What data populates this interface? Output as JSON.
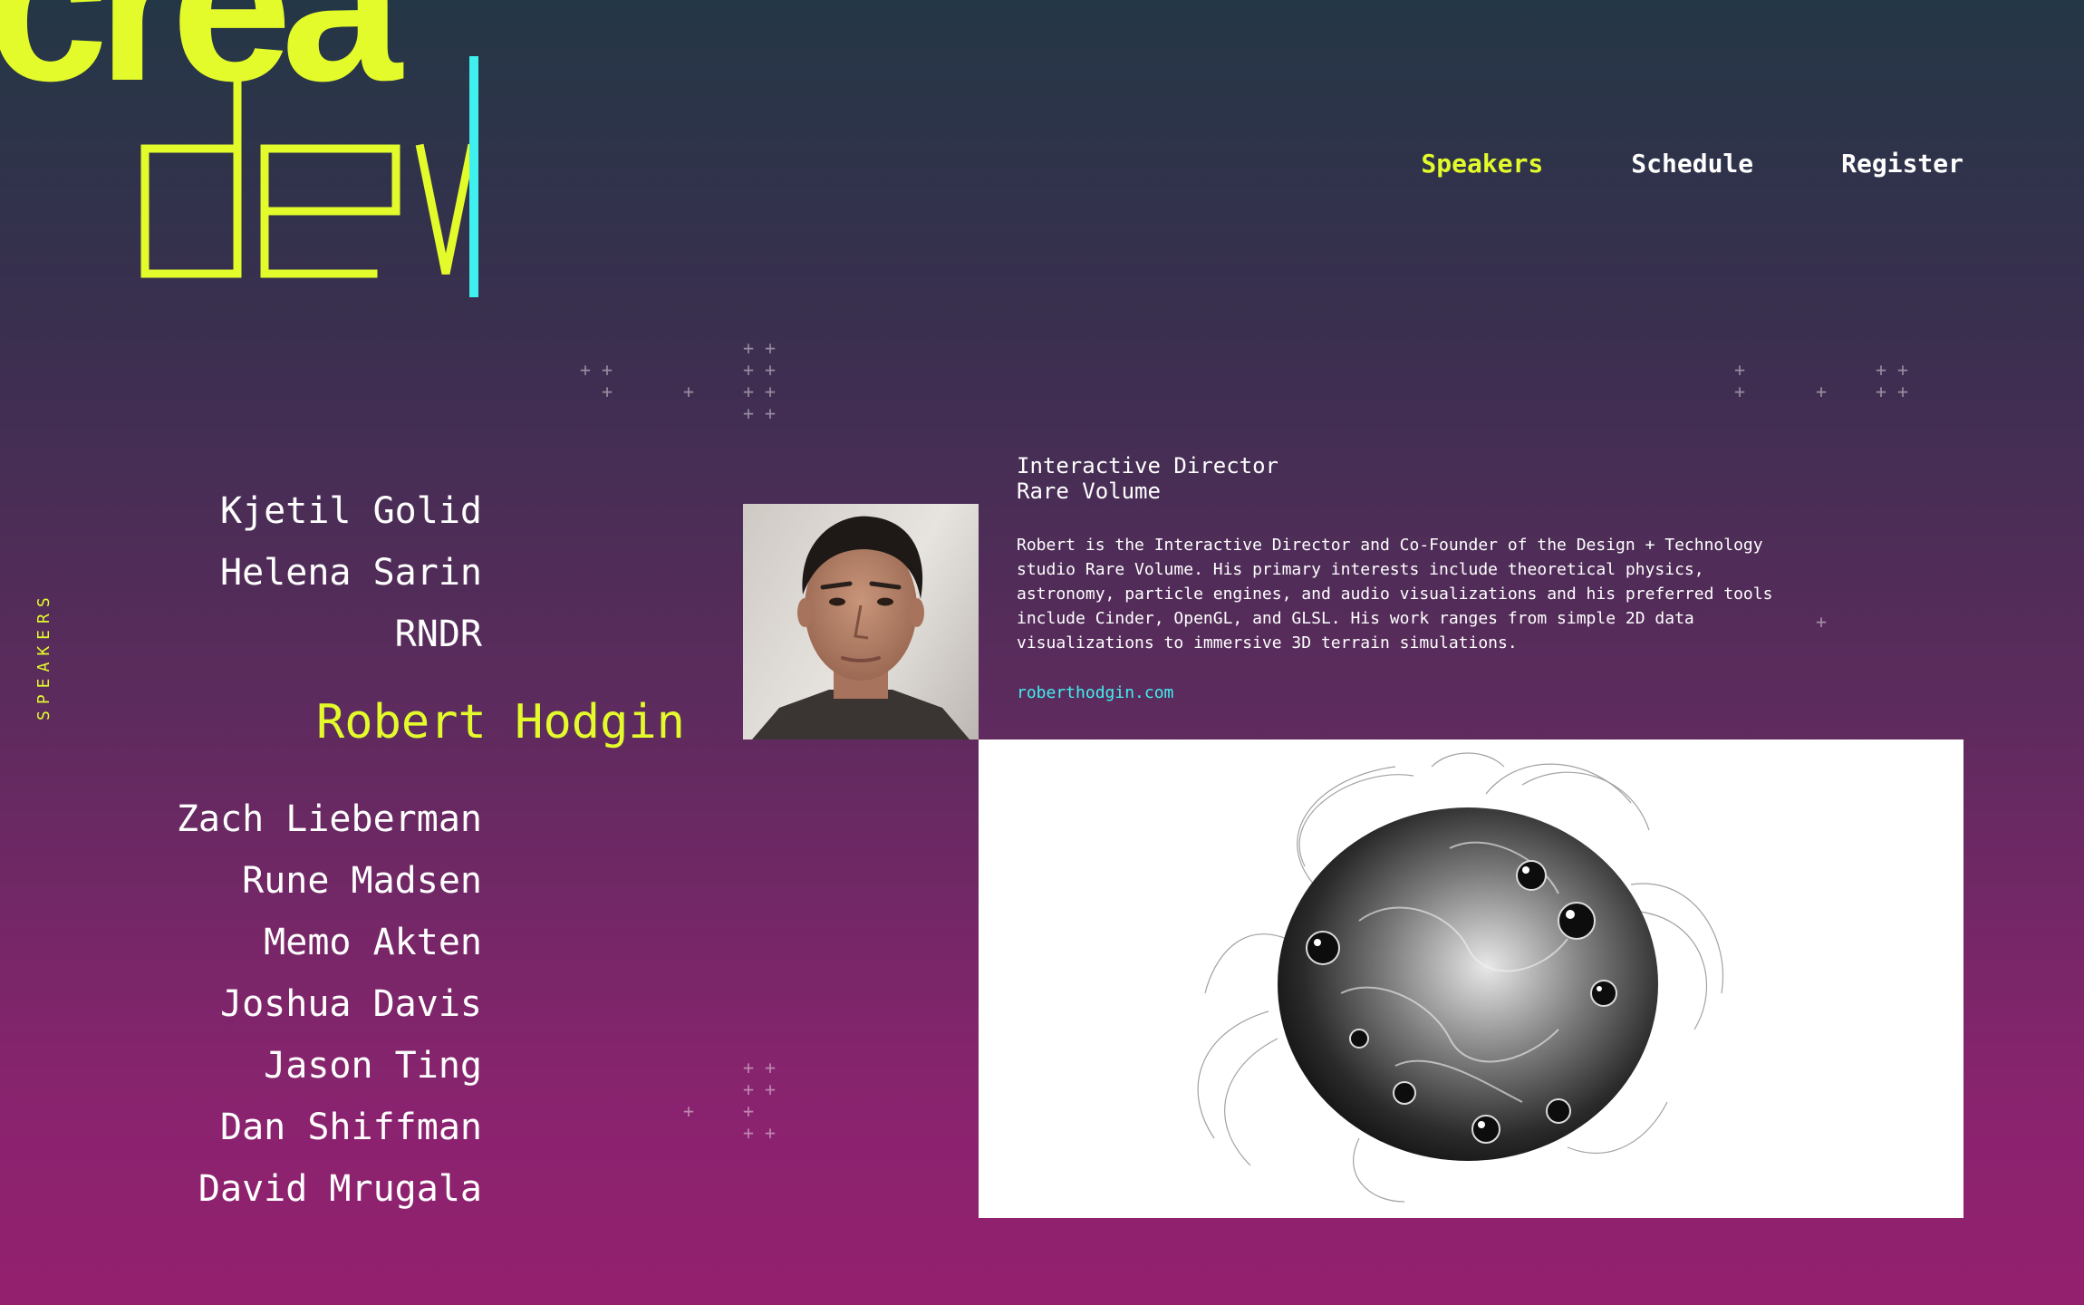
{
  "brand": {
    "logo_top": "crea",
    "logo_bottom": "dev",
    "logo_color": "#e3fb2a",
    "cursor_color": "#3ff0ef"
  },
  "nav": {
    "items": [
      {
        "label": "Speakers",
        "active": true
      },
      {
        "label": "Schedule",
        "active": false
      },
      {
        "label": "Register",
        "active": false
      }
    ]
  },
  "section_label": "SPEAKERS",
  "speakers": {
    "before": [
      "Kjetil Golid",
      "Helena Sarin",
      "RNDR"
    ],
    "active": "Robert Hodgin",
    "after": [
      "Zach Lieberman",
      "Rune Madsen",
      "Memo Akten",
      "Joshua Davis",
      "Jason Ting",
      "Dan Shiffman",
      "David Mrugala"
    ]
  },
  "detail": {
    "title": "Interactive Director",
    "company": "Rare Volume",
    "bio": "Robert is the Interactive Director and Co-Founder of the Design + Technology studio Rare Volume. His primary interests include theoretical physics, astronomy, particle engines, and audio visualizations and his preferred tools include Cinder, OpenGL, and GLSL. His work ranges from simple 2D data visualizations to immersive 3D terrain simulations.",
    "link": "roberthodgin.com"
  },
  "colors": {
    "accent": "#e3fb2a",
    "link": "#3ff0ef",
    "text": "#ffffff",
    "bg_top": "#243746",
    "bg_bottom": "#93206f"
  },
  "icons": {
    "decor": "plus-icon"
  }
}
